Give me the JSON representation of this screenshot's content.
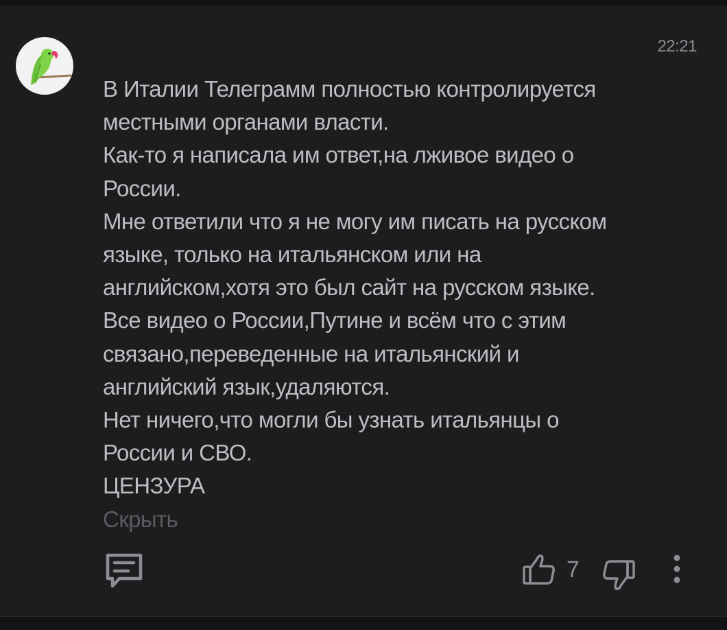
{
  "comment": {
    "timestamp": "22:21",
    "avatar_icon": "parrot-avatar-icon",
    "lines": [
      "В Италии Телеграмм полностью контролируется",
      "местными органами власти.",
      "Как-то я написала им ответ,на лживое видео о",
      "России.",
      "Мне ответили что я не могу им писать на русском",
      "языке, только на итальянском или на",
      "английском,хотя это был сайт на русском языке.",
      "Все видео о России,Путине и всём что с этим",
      "связано,переведенные на итальянский и",
      "английский язык,удаляются.",
      "Нет ничего,что могли бы узнать итальянцы о",
      "России и СВО.",
      "ЦЕНЗУРА"
    ],
    "hide_label": "Скрыть"
  },
  "actions": {
    "reply_icon": "reply-comment-icon",
    "like_icon": "thumbs-up-icon",
    "like_count": "7",
    "dislike_icon": "thumbs-down-icon",
    "more_icon": "more-vertical-icon"
  },
  "colors": {
    "background": "#1d1d1f",
    "text": "#bdbdc2",
    "muted": "#8d8d92",
    "hide_link": "#5a5a5f",
    "parrot_green": "#6cc03a",
    "parrot_beak": "#e83d6b"
  }
}
